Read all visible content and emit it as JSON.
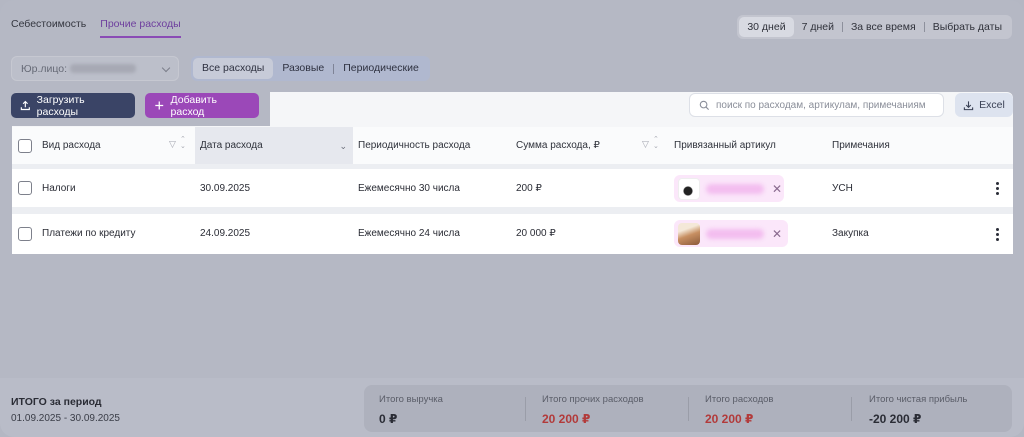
{
  "tabs": [
    {
      "label": "Себестоимость"
    },
    {
      "label": "Прочие расходы"
    }
  ],
  "period": {
    "options": [
      "30 дней",
      "7 дней",
      "За все время",
      "Выбрать даты"
    ]
  },
  "filters": {
    "legal_label": "Юр.лицо:",
    "types": [
      "Все расходы",
      "Разовые",
      "Периодические"
    ]
  },
  "toolbar": {
    "upload_label": "Загрузить расходы",
    "add_label": "Добавить расход",
    "search_placeholder": "поиск по расходам, артикулам, примечаниям",
    "excel_label": "Excel"
  },
  "table": {
    "headers": {
      "type": "Вид расхода",
      "date": "Дата расхода",
      "periodicity": "Периодичность расхода",
      "amount": "Сумма расхода, ₽",
      "article": "Привязанный артикул",
      "notes": "Примечания"
    },
    "rows": [
      {
        "type": "Налоги",
        "date": "30.09.2025",
        "periodicity": "Ежемесячно 30 числа",
        "amount": "200 ₽",
        "notes": "УСН"
      },
      {
        "type": "Платежи по кредиту",
        "date": "24.09.2025",
        "periodicity": "Ежемесячно 24 числа",
        "amount": "20 000 ₽",
        "notes": "Закупка"
      }
    ]
  },
  "footer": {
    "title": "ИТОГО за период",
    "range": "01.09.2025 - 30.09.2025",
    "totals": [
      {
        "label": "Итого выручка",
        "value": "0 ₽"
      },
      {
        "label": "Итого прочих расходов",
        "value": "20 200 ₽"
      },
      {
        "label": "Итого расходов",
        "value": "20 200 ₽"
      },
      {
        "label": "Итого чистая прибыль",
        "value": "-20 200 ₽"
      }
    ]
  },
  "colors": {
    "accent": "#9b48b8",
    "primary_button": "#3a4466",
    "negative": "#b23a3a"
  }
}
